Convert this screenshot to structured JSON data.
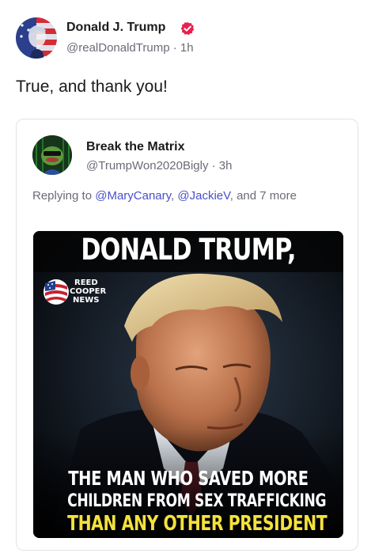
{
  "post": {
    "author_name": "Donald J. Trump",
    "handle_time": "@realDonaldTrump · 1h",
    "text": "True, and thank you!"
  },
  "quote": {
    "author_name": "Break the Matrix",
    "handle_time": "@TrumpWon2020Bigly · 3h",
    "replying_prefix": "Replying to ",
    "mentions": [
      "@MaryCanary",
      "@JackieV"
    ],
    "separator": ", ",
    "replying_suffix": ", and 7 more"
  },
  "meme": {
    "top_text": "DONALD TRUMP,",
    "logo_lines": [
      "REED",
      "COOPER",
      "NEWS"
    ],
    "bottom_lines": [
      "THE MAN WHO SAVED MORE",
      "CHILDREN FROM SEX TRAFFICKING",
      "THAN ANY OTHER PRESIDENT"
    ]
  },
  "colors": {
    "verified": "#e8214f",
    "mention": "#4b4fc8",
    "meme_highlight": "#f4e23b"
  },
  "icons": {
    "verified": "verified-badge-icon"
  }
}
